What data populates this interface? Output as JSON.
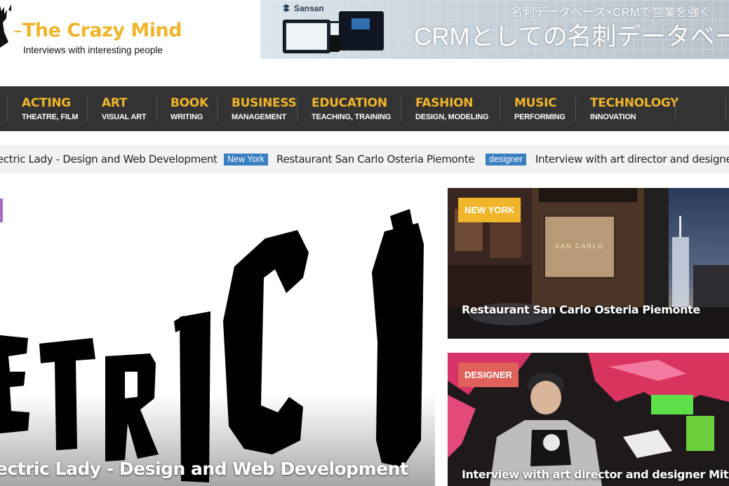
{
  "site": {
    "title": "The Crazy Mind",
    "tagline": "Interviews with interesting people",
    "accent_color": "#f0b52b",
    "nav_bg": "#333333"
  },
  "ad": {
    "brand": "Sansan",
    "line1": "名刺データベース×CRMで営業を強く",
    "line2": "CRMとしての名刺データベー"
  },
  "nav": {
    "items": [
      {
        "title": "ACTING",
        "sub": "THEATRE, FILM"
      },
      {
        "title": "ART",
        "sub": "VISUAL ART"
      },
      {
        "title": "BOOK",
        "sub": "WRITING"
      },
      {
        "title": "BUSINESS",
        "sub": "MANAGEMENT"
      },
      {
        "title": "EDUCATION",
        "sub": "TEACHING, TRAINING"
      },
      {
        "title": "FASHION",
        "sub": "DESIGN, MODELING"
      },
      {
        "title": "MUSIC",
        "sub": "PERFORMING"
      },
      {
        "title": "TECHNOLOGY",
        "sub": "INNOVATION"
      }
    ]
  },
  "ticker": {
    "items": [
      {
        "badge": "",
        "text": "ectric Lady - Design and Web Development"
      },
      {
        "badge": "New York",
        "text": "Restaurant San Carlo Osteria Piemonte"
      },
      {
        "badge": "designer",
        "text": "Interview with art director and designer"
      }
    ],
    "badge_color": "#3a7fc1"
  },
  "feature": {
    "title": "ectric Lady - Design and Web Development",
    "art_text": "ETRIC",
    "tag_color": "#a66bc2"
  },
  "cards": [
    {
      "badge": "NEW YORK",
      "badge_color": "#f0b52b",
      "title": "Restaurant San Carlo Osteria Piemonte",
      "sign_text": "SAN CARLO"
    },
    {
      "badge": "DESIGNER",
      "badge_color": "#e0605a",
      "title": "Interview with art director and designer Mitxel Gor"
    }
  ]
}
